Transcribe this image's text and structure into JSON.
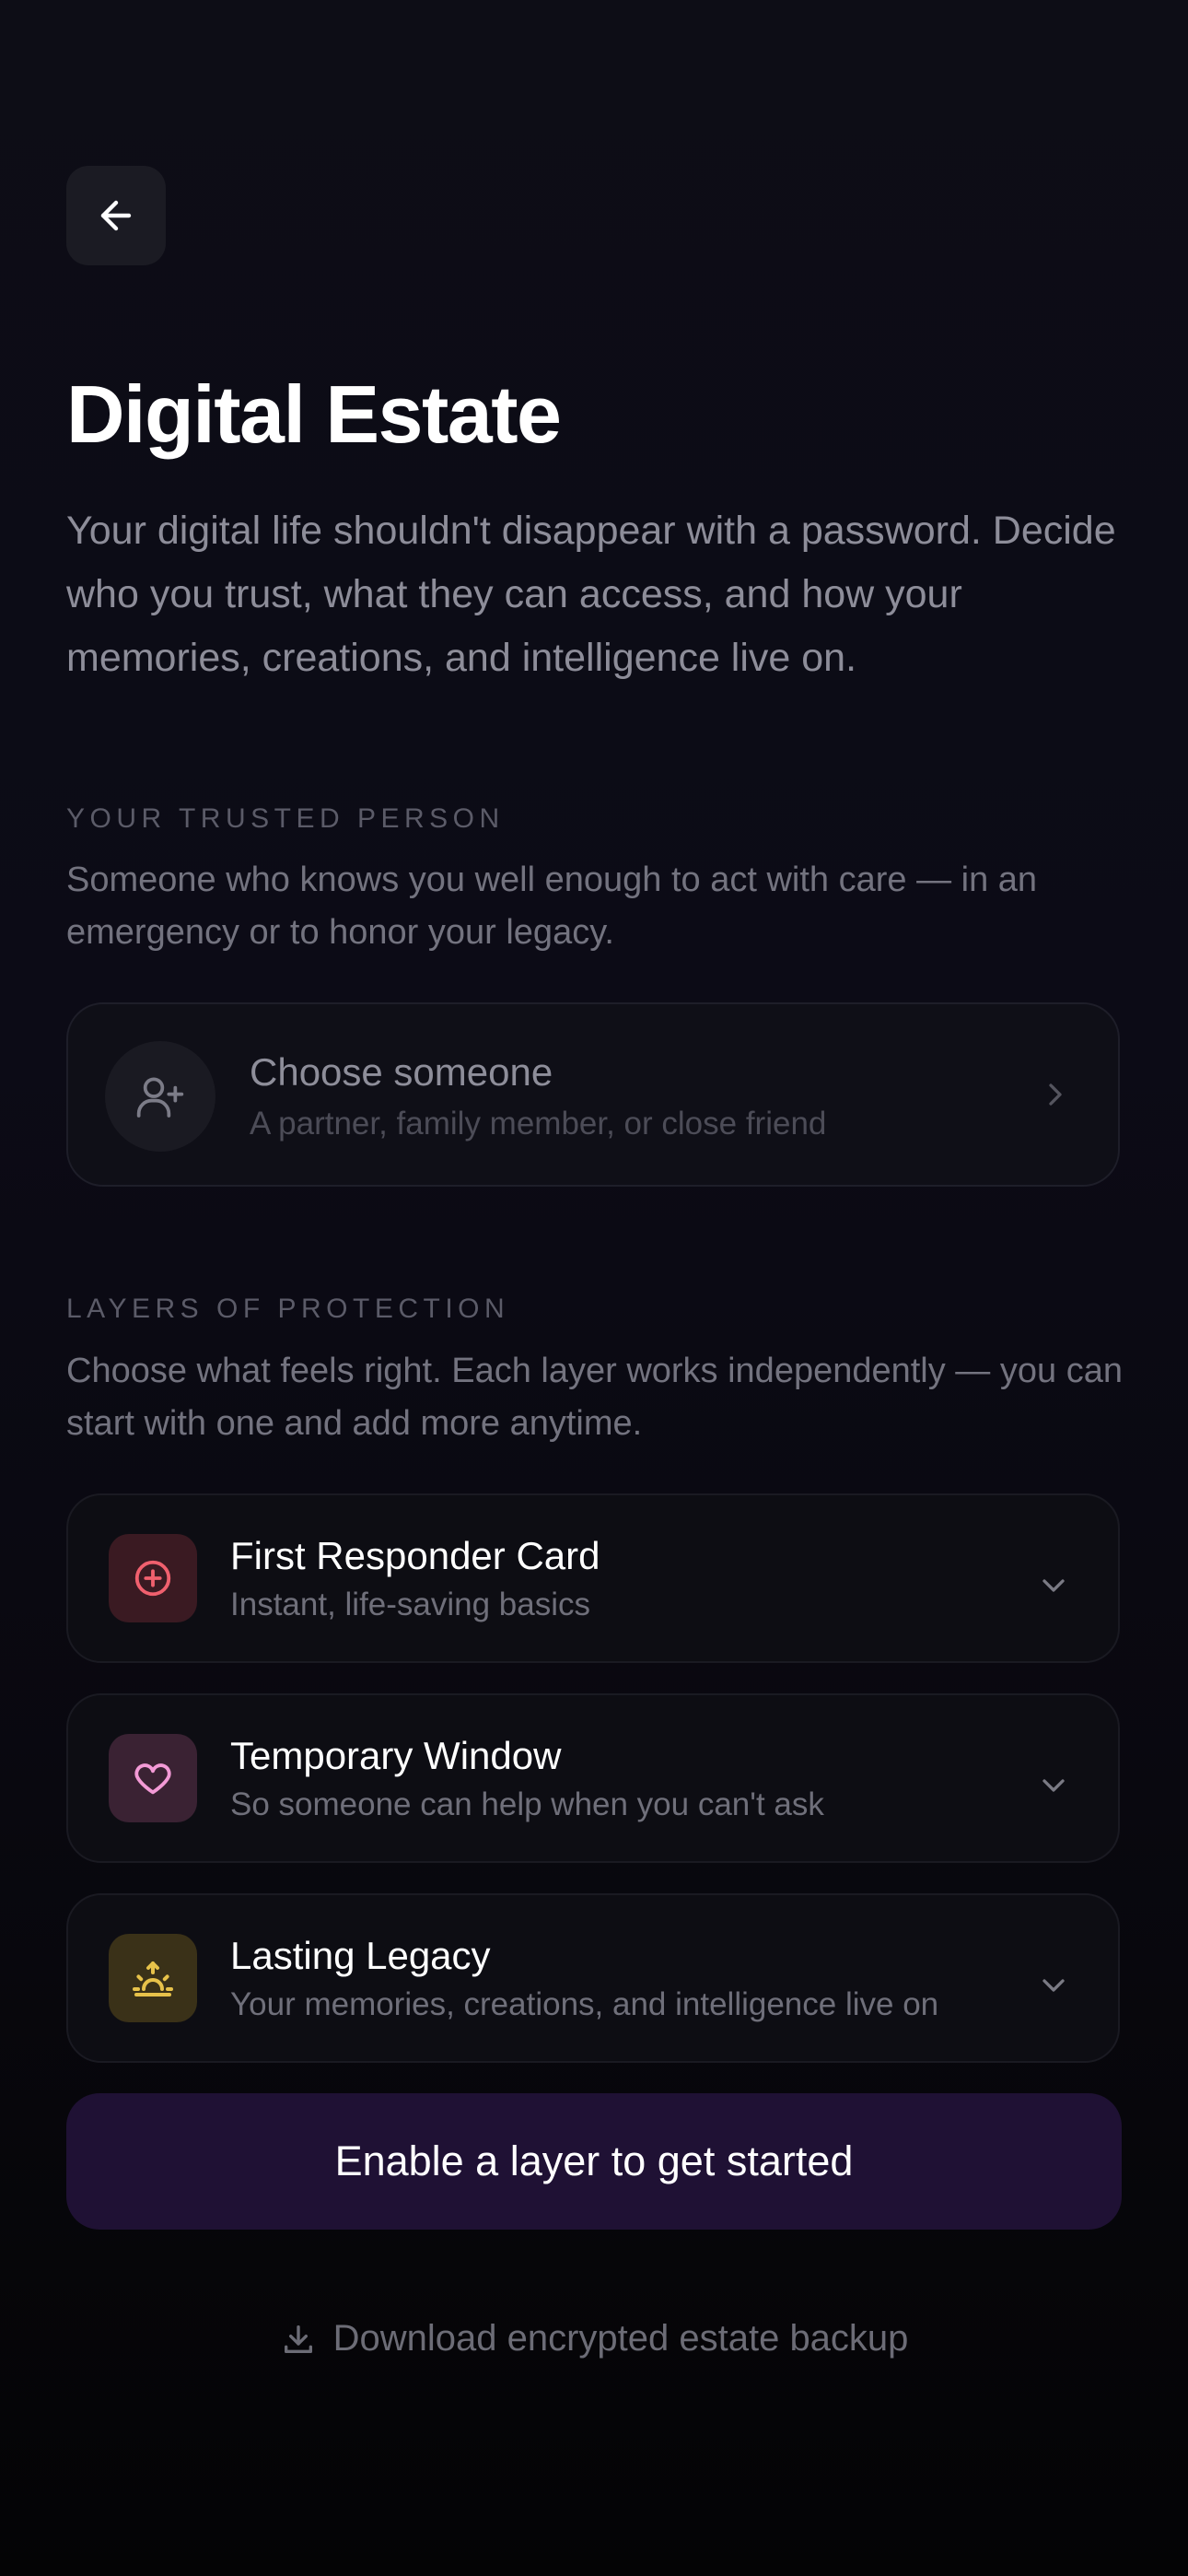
{
  "header": {
    "back_icon": "arrow-left-icon",
    "title": "Digital Estate",
    "intro": "Your digital life shouldn't disappear with a password. Decide who you trust, what they can access, and how your memories, creations, and intelligence live on."
  },
  "trusted": {
    "eyebrow": "YOUR TRUSTED PERSON",
    "description": "Someone who knows you well enough to act with care — in an emergency or to honor your legacy.",
    "card": {
      "icon": "user-plus-icon",
      "title": "Choose someone",
      "subtitle": "A partner, family member, or close friend",
      "chevron": "chevron-right-icon"
    }
  },
  "layers": {
    "eyebrow": "LAYERS OF PROTECTION",
    "description": "Choose what feels right. Each layer works independently — you can start with one and add more anytime.",
    "items": [
      {
        "title": "First Responder Card",
        "subtitle": "Instant, life-saving basics",
        "icon": "plus-circle-icon",
        "accent": "#f0606e",
        "icon_bg": "#3a1a22"
      },
      {
        "title": "Temporary Window",
        "subtitle": "So someone can help when you can't ask",
        "icon": "heart-icon",
        "accent": "#f39ad6",
        "icon_bg": "#3a2233"
      },
      {
        "title": "Lasting Legacy",
        "subtitle": "Your memories, creations, and intelligence live on",
        "icon": "sunrise-icon",
        "accent": "#e7c24a",
        "icon_bg": "#3a3118"
      }
    ]
  },
  "cta": {
    "label": "Enable a layer to get started",
    "bg": "#1f1134"
  },
  "download": {
    "icon": "download-icon",
    "label": "Download encrypted estate backup"
  }
}
